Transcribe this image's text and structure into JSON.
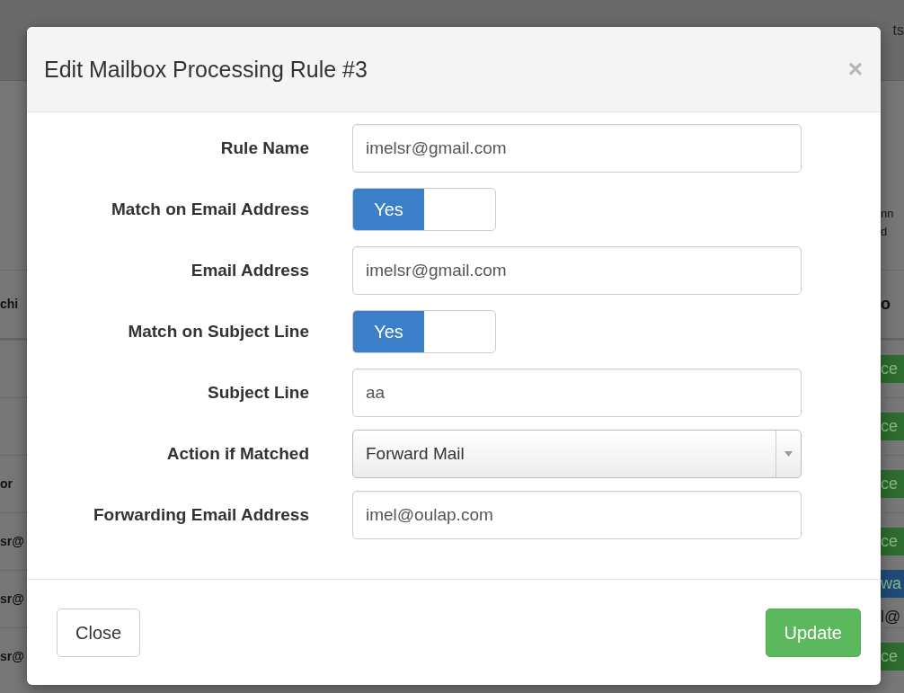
{
  "background": {
    "corner_text": "ts",
    "side_note": [
      "nn",
      "d"
    ],
    "rows": [
      {
        "kind": "header",
        "left": "chi",
        "right": "o"
      },
      {
        "kind": "badge",
        "right": "ce",
        "color": "#2e6b2e"
      },
      {
        "kind": "badge",
        "right": "ce",
        "color": "#2e6b2e"
      },
      {
        "kind": "badge",
        "left": "or",
        "right": "ce",
        "color": "#2e6b2e"
      },
      {
        "kind": "badge",
        "left": "sr@",
        "right": "ce",
        "color": "#2e6b2e"
      },
      {
        "kind": "badge",
        "left": "sr@",
        "right": "wa",
        "color": "#1f4a78",
        "right_extra": "l@"
      },
      {
        "kind": "badge",
        "left": "sr@",
        "right": "ce",
        "color": "#2e6b2e"
      }
    ]
  },
  "modal": {
    "title": "Edit Mailbox Processing Rule #3",
    "close": "×",
    "fields": [
      {
        "kind": "text",
        "label": "Rule Name",
        "value": "imelsr@gmail.com"
      },
      {
        "kind": "toggle",
        "label": "Match on Email Address",
        "on": true,
        "on_label": "Yes"
      },
      {
        "kind": "text",
        "label": "Email Address",
        "value": "imelsr@gmail.com"
      },
      {
        "kind": "toggle",
        "label": "Match on Subject Line",
        "on": true,
        "on_label": "Yes"
      },
      {
        "kind": "text",
        "label": "Subject Line",
        "value": "aa"
      },
      {
        "kind": "select",
        "label": "Action if Matched",
        "value": "Forward Mail"
      },
      {
        "kind": "text",
        "label": "Forwarding Email Address",
        "value": "imel@oulap.com"
      }
    ],
    "buttons": [
      {
        "label": "Close",
        "kind": "default"
      },
      {
        "label": "Update",
        "kind": "success"
      }
    ]
  }
}
